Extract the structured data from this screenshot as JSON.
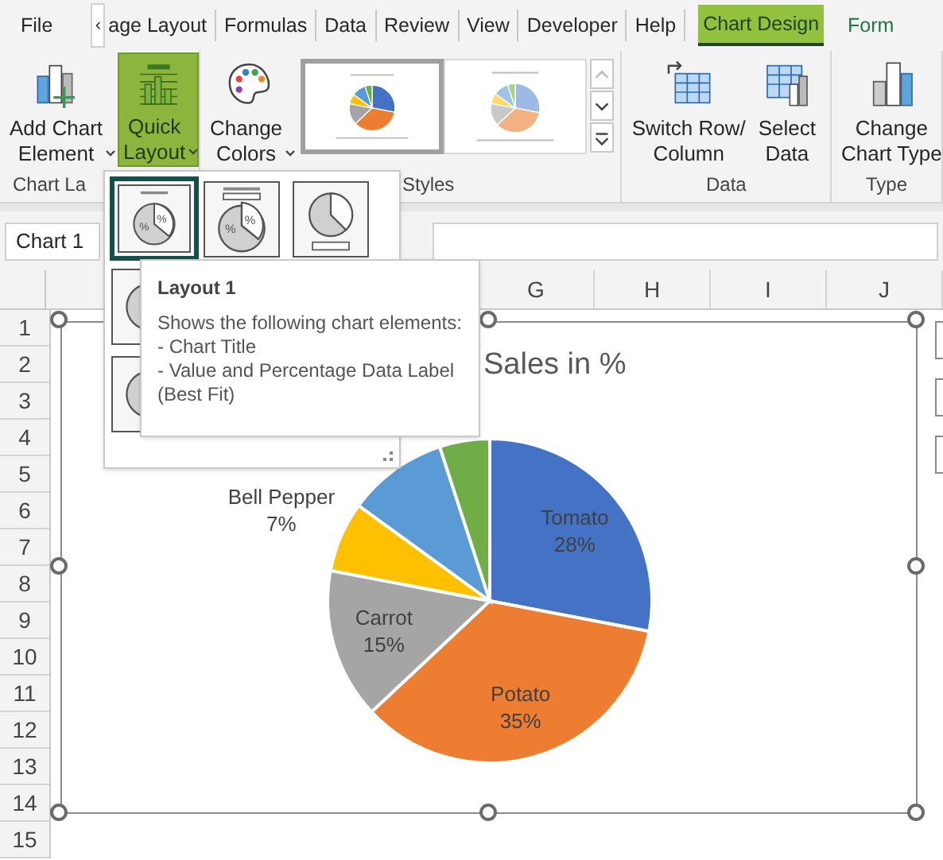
{
  "tab_scroll": "‹",
  "tabs": [
    {
      "label": "File",
      "selected": false
    },
    {
      "label": "age Layout",
      "selected": false
    },
    {
      "label": "Formulas",
      "selected": false
    },
    {
      "label": "Data",
      "selected": false
    },
    {
      "label": "Review",
      "selected": false
    },
    {
      "label": "View",
      "selected": false
    },
    {
      "label": "Developer",
      "selected": false
    },
    {
      "label": "Help",
      "selected": false
    },
    {
      "label": "Chart Design",
      "selected": true
    },
    {
      "label": "Form",
      "selected": false
    }
  ],
  "ribbon": {
    "groups": [
      {
        "label": "Chart La",
        "buttons": [
          {
            "kind": "add-element",
            "lines": [
              "Add Chart",
              "Element"
            ],
            "dropdown": true,
            "pressed": false
          },
          {
            "kind": "quick-layout",
            "lines": [
              "Quick",
              "Layout"
            ],
            "dropdown": true,
            "pressed": true
          }
        ]
      },
      {
        "label": "Styles",
        "buttons": [
          {
            "kind": "colors",
            "lines": [
              "Change",
              "Colors"
            ],
            "dropdown": true,
            "pressed": false
          }
        ],
        "gallery": [
          {
            "selected": true
          },
          {
            "selected": false
          }
        ]
      },
      {
        "label": "Data",
        "buttons": [
          {
            "kind": "switch",
            "lines": [
              "Switch Row/",
              "Column"
            ],
            "dropdown": false,
            "pressed": false
          },
          {
            "kind": "select-data",
            "lines": [
              "Select",
              "Data"
            ],
            "dropdown": false,
            "pressed": false
          }
        ]
      },
      {
        "label": "Type",
        "buttons": [
          {
            "kind": "chart-type",
            "lines": [
              "Change",
              "Chart Type"
            ],
            "dropdown": false,
            "pressed": false
          }
        ]
      }
    ]
  },
  "name_box": "Chart 1",
  "columns": [
    "G",
    "H",
    "I",
    "J"
  ],
  "rows": [
    "1",
    "2",
    "3",
    "4",
    "5",
    "6",
    "7",
    "8",
    "9",
    "10",
    "11",
    "12",
    "13",
    "14",
    "15"
  ],
  "chart": {
    "title": "Sales in %",
    "slices": [
      {
        "color": "#4472c4",
        "kind": "inside"
      },
      {
        "color": "#ed7d31",
        "kind": "inside"
      },
      {
        "color": "#a5a5a5",
        "kind": "inside"
      },
      {
        "color": "#ffc000",
        "kind": "outside"
      },
      {
        "color": "#5b9bd5",
        "kind": "hidden"
      },
      {
        "color": "#70ad47",
        "kind": "hidden"
      }
    ],
    "chart_data": {
      "type": "pie",
      "categories": [
        "Tomato",
        "Potato",
        "Carrot",
        "Bell Pepper",
        null,
        null
      ],
      "values": [
        28,
        35,
        15,
        7,
        10,
        5
      ],
      "value_labels": [
        "28%",
        "35%",
        "15%",
        "7%",
        null,
        null
      ]
    }
  },
  "quick_layouts": [
    {
      "kind": "title-labels",
      "selected": true,
      "marks": [
        "%",
        "%"
      ]
    },
    {
      "kind": "title-legend-labels",
      "selected": false,
      "marks": [
        "%",
        "%"
      ]
    },
    {
      "kind": "legend-bottom",
      "selected": false
    },
    {
      "kind": "partial",
      "selected": false
    },
    {
      "kind": "partial",
      "selected": false
    }
  ],
  "tooltip": {
    "title": "Layout 1",
    "description": "Shows the following chart elements:",
    "items": [
      "- Chart Title",
      "- Value and Percentage Data Label (Best Fit)"
    ]
  }
}
